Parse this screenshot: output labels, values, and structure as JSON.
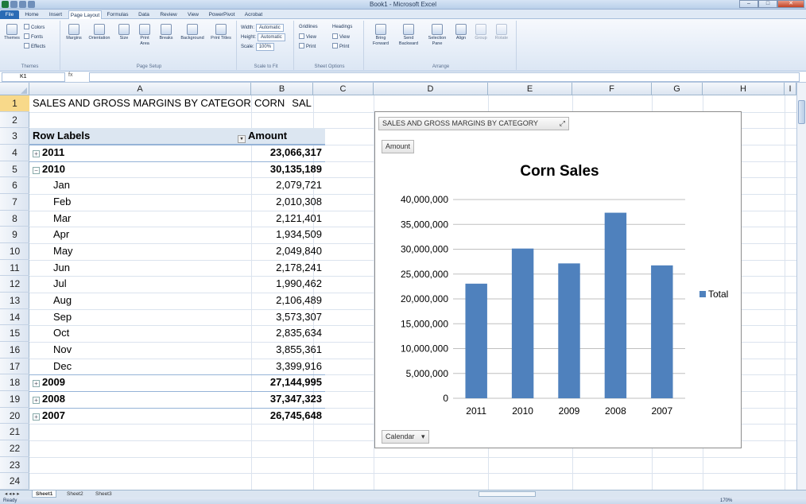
{
  "window": {
    "title": "Book1 - Microsoft Excel",
    "min_label": "–",
    "max_label": "□",
    "close_label": "✕"
  },
  "ribbon_tabs": [
    {
      "label": "File",
      "active": false
    },
    {
      "label": "Home",
      "active": false
    },
    {
      "label": "Insert",
      "active": false
    },
    {
      "label": "Page Layout",
      "active": true
    },
    {
      "label": "Formulas",
      "active": false
    },
    {
      "label": "Data",
      "active": false
    },
    {
      "label": "Review",
      "active": false
    },
    {
      "label": "View",
      "active": false
    },
    {
      "label": "PowerPivot",
      "active": false
    },
    {
      "label": "Acrobat",
      "active": false
    }
  ],
  "ribbon": {
    "themes": {
      "themes": "Themes",
      "colors": "Colors",
      "fonts": "Fonts",
      "effects": "Effects",
      "group": "Themes"
    },
    "page_setup": {
      "margins": "Margins",
      "orientation": "Orientation",
      "size": "Size",
      "print_area": "Print Area",
      "breaks": "Breaks",
      "background": "Background",
      "print_titles": "Print Titles",
      "group": "Page Setup"
    },
    "scale_to_fit": {
      "width_label": "Width:",
      "width_value": "Automatic",
      "height_label": "Height:",
      "height_value": "Automatic",
      "scale_label": "Scale:",
      "scale_value": "100%",
      "group": "Scale to Fit"
    },
    "sheet_options": {
      "gridlines": "Gridlines",
      "headings": "Headings",
      "view": "View",
      "print": "Print",
      "group": "Sheet Options"
    },
    "arrange": {
      "bring_forward": "Bring Forward",
      "send_backward": "Send Backward",
      "selection_pane": "Selection Pane",
      "align": "Align",
      "group_btn": "Group",
      "rotate": "Rotate",
      "group": "Arrange"
    }
  },
  "formula_bar": {
    "name_box": "K1",
    "fx": "fx",
    "formula": ""
  },
  "columns": [
    "A",
    "B",
    "C",
    "D",
    "E",
    "F",
    "G",
    "H",
    "I"
  ],
  "rows": [
    "1",
    "2",
    "3",
    "4",
    "5",
    "6",
    "7",
    "8",
    "9",
    "10",
    "11",
    "12",
    "13",
    "14",
    "15",
    "16",
    "17",
    "18",
    "19",
    "20",
    "21",
    "22",
    "23",
    "24"
  ],
  "pivot": {
    "title": "SALES AND GROSS MARGINS BY CATEGORY",
    "filter_value": "CORN",
    "filter_field": "SALES",
    "row_labels_header": "Row Labels",
    "amount_header": "Amount",
    "collapsed_sign": "+",
    "expanded_sign": "−",
    "dropdown_glyph": "▾",
    "filter_glyph": "▾",
    "lines": [
      {
        "label": "2011",
        "value": "23,066,317",
        "type": "year",
        "expanded": false
      },
      {
        "label": "2010",
        "value": "30,135,189",
        "type": "year",
        "expanded": true
      },
      {
        "label": "Jan",
        "value": "2,079,721",
        "type": "month"
      },
      {
        "label": "Feb",
        "value": "2,010,308",
        "type": "month"
      },
      {
        "label": "Mar",
        "value": "2,121,401",
        "type": "month"
      },
      {
        "label": "Apr",
        "value": "1,934,509",
        "type": "month"
      },
      {
        "label": "May",
        "value": "2,049,840",
        "type": "month"
      },
      {
        "label": "Jun",
        "value": "2,178,241",
        "type": "month"
      },
      {
        "label": "Jul",
        "value": "1,990,462",
        "type": "month"
      },
      {
        "label": "Aug",
        "value": "2,106,489",
        "type": "month"
      },
      {
        "label": "Sep",
        "value": "3,573,307",
        "type": "month"
      },
      {
        "label": "Oct",
        "value": "2,835,634",
        "type": "month"
      },
      {
        "label": "Nov",
        "value": "3,855,361",
        "type": "month"
      },
      {
        "label": "Dec",
        "value": "3,399,916",
        "type": "month"
      },
      {
        "label": "2009",
        "value": "27,144,995",
        "type": "year",
        "expanded": false
      },
      {
        "label": "2008",
        "value": "37,347,323",
        "type": "year",
        "expanded": false
      },
      {
        "label": "2007",
        "value": "26,745,648",
        "type": "year",
        "expanded": false
      }
    ]
  },
  "chart_panel": {
    "filter_button": "SALES AND GROSS MARGINS BY CATEGORY",
    "value_button": "Amount",
    "axis_button": "Calendar",
    "dropdown_glyph": "▾",
    "expand_glyph": "⤢"
  },
  "chart_data": {
    "type": "bar",
    "title": "Corn Sales",
    "categories": [
      "2011",
      "2010",
      "2009",
      "2008",
      "2007"
    ],
    "series": [
      {
        "name": "Total",
        "values": [
          23066317,
          30135189,
          27144995,
          37347323,
          26745648
        ],
        "color": "#4f81bd"
      }
    ],
    "ylim": [
      0,
      40000000
    ],
    "yticks": [
      "0",
      "5,000,000",
      "10,000,000",
      "15,000,000",
      "20,000,000",
      "25,000,000",
      "30,000,000",
      "35,000,000",
      "40,000,000"
    ],
    "grid": true,
    "legend": "right"
  },
  "sheets": [
    {
      "label": "Sheet1",
      "active": true
    },
    {
      "label": "Sheet2",
      "active": false
    },
    {
      "label": "Sheet3",
      "active": false
    }
  ],
  "sheet_nav": "◂ ◂ ▸ ▸",
  "status": {
    "ready": "Ready",
    "zoom": "170%"
  },
  "colors": {
    "accent": "#4f81bd",
    "header_fill": "#dce6f1",
    "selected_row": "#f8d98a"
  }
}
